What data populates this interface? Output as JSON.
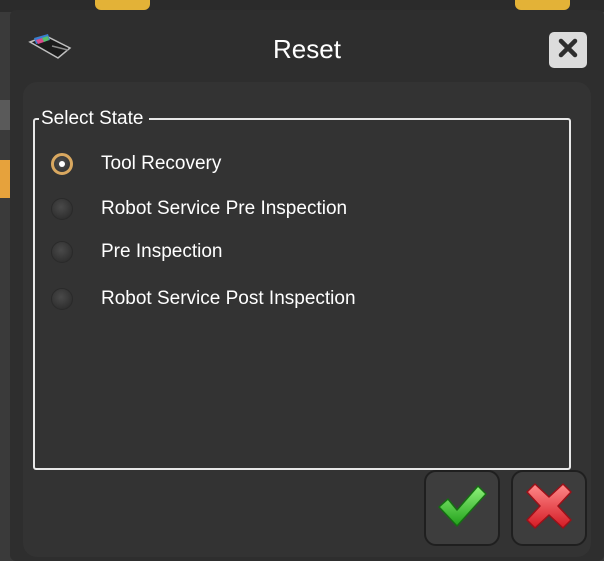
{
  "dialog": {
    "title": "Reset",
    "close_icon": "close-x-icon",
    "logo_icon": "app-logo-icon"
  },
  "state_group": {
    "legend": "Select State",
    "selected": "Tool Recovery",
    "options": [
      {
        "label": "Tool Recovery",
        "checked": true
      },
      {
        "label": "Robot Service Pre Inspection",
        "checked": false
      },
      {
        "label": "Pre Inspection",
        "checked": false
      },
      {
        "label": "Robot Service Post Inspection",
        "checked": false
      }
    ]
  },
  "actions": {
    "confirm_icon": "green-checkmark-icon",
    "cancel_icon": "red-x-icon"
  },
  "colors": {
    "dialog_bg": "#2e2e2e",
    "panel_bg": "#333333",
    "radio_selected_ring": "#d9a860",
    "confirm": "#3fbf2a",
    "cancel": "#e8333a"
  }
}
